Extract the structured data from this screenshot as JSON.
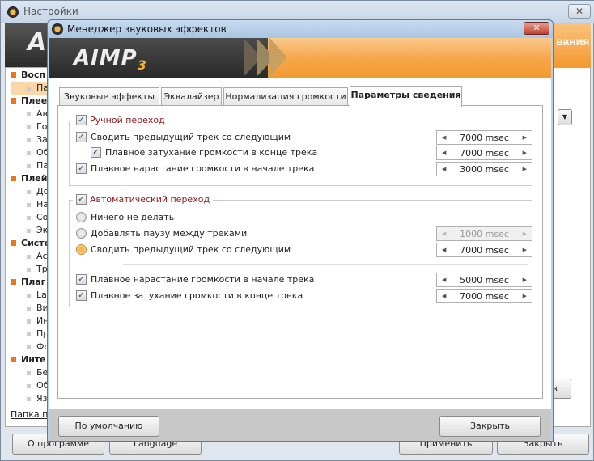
{
  "background_window": {
    "title": "Настройки",
    "header_logo_fragment": "A",
    "header_right_fragment": "вания",
    "tree": [
      {
        "label": "Восп",
        "type": "cat"
      },
      {
        "label": "Па",
        "type": "sub",
        "selected": true
      },
      {
        "label": "Плее",
        "type": "cat"
      },
      {
        "label": "Ав",
        "type": "sub"
      },
      {
        "label": "Го",
        "type": "sub"
      },
      {
        "label": "За",
        "type": "sub"
      },
      {
        "label": "Об",
        "type": "sub"
      },
      {
        "label": "Па",
        "type": "sub"
      },
      {
        "label": "Плей",
        "type": "cat"
      },
      {
        "label": "До",
        "type": "sub"
      },
      {
        "label": "На",
        "type": "sub"
      },
      {
        "label": "Со",
        "type": "sub"
      },
      {
        "label": "Эк",
        "type": "sub"
      },
      {
        "label": "Систе",
        "type": "cat"
      },
      {
        "label": "Ас",
        "type": "sub"
      },
      {
        "label": "Тр",
        "type": "sub"
      },
      {
        "label": "Плаг",
        "type": "cat"
      },
      {
        "label": "La",
        "type": "sub"
      },
      {
        "label": "Ви",
        "type": "sub"
      },
      {
        "label": "Ин",
        "type": "sub"
      },
      {
        "label": "Пр",
        "type": "sub"
      },
      {
        "label": "Фо",
        "type": "sub"
      },
      {
        "label": "Инте",
        "type": "cat"
      },
      {
        "label": "Бе",
        "type": "sub"
      },
      {
        "label": "Об",
        "type": "sub"
      },
      {
        "label": "Яз",
        "type": "sub"
      }
    ],
    "folder_link": "Папка пр",
    "right_button_fragment": "в",
    "buttons": {
      "about": "О программе",
      "language": "Language",
      "apply": "Применить",
      "close": "Закрыть"
    }
  },
  "dialog": {
    "title": "Менеджер звуковых эффектов",
    "logo": "AIMP",
    "logo_version": "3",
    "tabs": [
      {
        "label": "Звуковые эффекты"
      },
      {
        "label": "Эквалайзер"
      },
      {
        "label": "Нормализация громкости"
      },
      {
        "label": "Параметры сведения",
        "active": true
      }
    ],
    "manual": {
      "label": "Ручной переход",
      "checked": true,
      "items": [
        {
          "label": "Сводить предыдущий трек со следующим",
          "checked": true,
          "value": "7000 msec"
        },
        {
          "label": "Плавное затухание громкости в конце трека",
          "checked": true,
          "value": "7000 msec"
        },
        {
          "label": "Плавное нарастание громкости в начале трека",
          "checked": true,
          "value": "3000 msec"
        }
      ]
    },
    "auto": {
      "label": "Автоматический переход",
      "checked": true,
      "radios": [
        {
          "label": "Ничего не делать",
          "selected": false
        },
        {
          "label": "Добавлять паузу между треками",
          "selected": false,
          "value": "1000 msec",
          "disabled": true
        },
        {
          "label": "Сводить предыдущий трек со следующим",
          "selected": true,
          "value": "7000 msec"
        }
      ],
      "items": [
        {
          "label": "Плавное нарастание громкости в начале трека",
          "checked": true,
          "value": "5000 msec"
        },
        {
          "label": "Плавное затухание громкости в конце трека",
          "checked": true,
          "value": "7000 msec"
        }
      ]
    },
    "buttons": {
      "defaults": "По умолчанию",
      "close": "Закрыть"
    }
  },
  "colors": {
    "accent": "#f39a2e",
    "legend": "#8b1a1a",
    "selected_tree": "#fad7a8"
  }
}
